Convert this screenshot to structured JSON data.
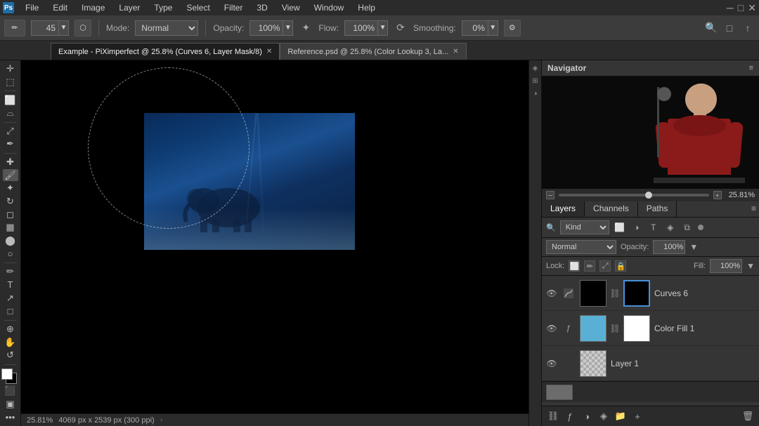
{
  "menubar": {
    "app_icon": "Ps",
    "items": [
      "File",
      "Edit",
      "Image",
      "Layer",
      "Type",
      "Select",
      "Filter",
      "3D",
      "View",
      "Window",
      "Help"
    ]
  },
  "toolbar": {
    "brush_size_label": "45",
    "mode_label": "Mode:",
    "mode_value": "Normal",
    "opacity_label": "Opacity:",
    "opacity_value": "100%",
    "flow_label": "Flow:",
    "flow_value": "100%",
    "smoothing_label": "Smoothing:",
    "smoothing_value": "0%"
  },
  "tabs": [
    {
      "label": "Example - PiXimperfect @ 25.8% (Curves 6, Layer Mask/8)",
      "active": true
    },
    {
      "label": "Reference.psd @ 25.8% (Color Lookup 3, La...",
      "active": false
    }
  ],
  "canvas": {
    "status_zoom": "25.81%",
    "status_dimensions": "4069 px x 2539 px (300 ppi)"
  },
  "navigator": {
    "title": "Navigator",
    "zoom_value": "25.81%"
  },
  "layers": {
    "tabs": [
      "Layers",
      "Channels",
      "Paths"
    ],
    "active_tab": "Layers",
    "kind_label": "Kind",
    "blend_mode": "Normal",
    "opacity_label": "Opacity:",
    "opacity_value": "100%",
    "lock_label": "Lock:",
    "fill_label": "Fill:",
    "fill_value": "100%",
    "items": [
      {
        "name": "Curves 6",
        "eye": true,
        "has_link": true,
        "thumb_type": "curves",
        "mask_type": "curves_mask"
      },
      {
        "name": "Color Fill 1",
        "eye": true,
        "has_extra": true,
        "has_link": true,
        "thumb_type": "colorfill",
        "mask_type": "white"
      },
      {
        "name": "Layer 1",
        "eye": true,
        "thumb_type": "checker",
        "mask_type": "none"
      }
    ]
  }
}
